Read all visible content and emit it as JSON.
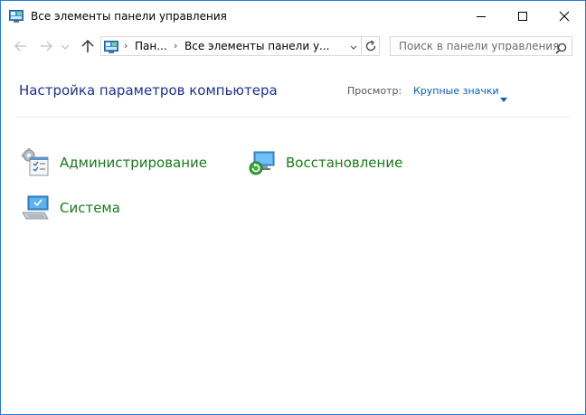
{
  "window": {
    "title": "Все элементы панели управления"
  },
  "titlebar_buttons": {
    "minimize": "minimize-icon",
    "maximize": "maximize-icon",
    "close": "close-icon"
  },
  "nav": {
    "back": "arrow-left-icon",
    "forward": "arrow-right-icon",
    "recent": "chevron-down-icon",
    "up": "arrow-up-icon"
  },
  "address": {
    "crumbs": [
      "Пан...",
      "Все элементы панели у..."
    ],
    "separator": "›"
  },
  "search": {
    "placeholder": "Поиск в панели управления"
  },
  "content": {
    "heading": "Настройка параметров компьютера",
    "view_label": "Просмотр:",
    "view_value": "Крупные значки"
  },
  "items": [
    {
      "label": "Администрирование",
      "icon": "administrative-tools-icon"
    },
    {
      "label": "Восстановление",
      "icon": "recovery-icon"
    },
    {
      "label": "Система",
      "icon": "system-icon"
    }
  ],
  "colors": {
    "heading": "#1e3287",
    "link": "#1a7a1a",
    "view_link": "#0a5fb4",
    "border": "#2b79d6"
  }
}
